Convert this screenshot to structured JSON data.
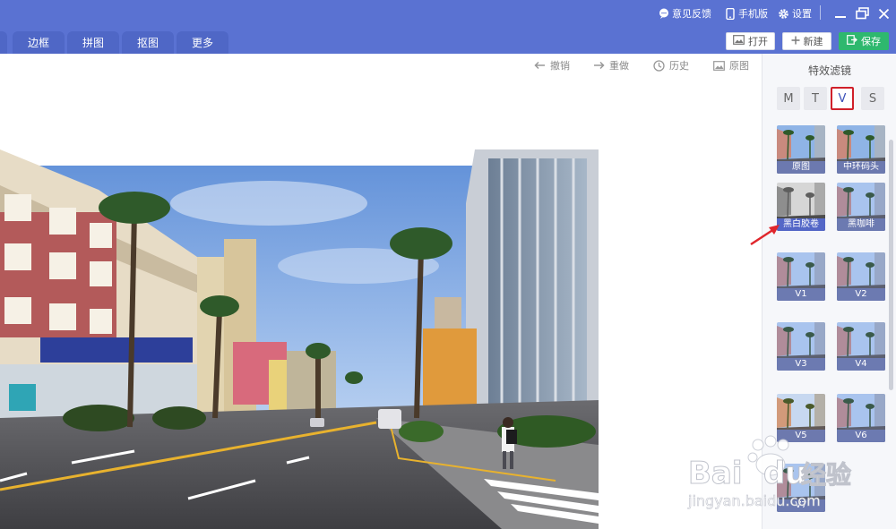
{
  "titlebar": {
    "feedback_label": "意见反馈",
    "mobile_label": "手机版",
    "settings_label": "设置"
  },
  "tabs": [
    {
      "label": ""
    },
    {
      "label": "边框"
    },
    {
      "label": "拼图"
    },
    {
      "label": "抠图"
    },
    {
      "label": "更多"
    }
  ],
  "actions": {
    "open_label": "打开",
    "new_label": "新建",
    "save_label": "保存"
  },
  "canvas_toolbar": {
    "undo_label": "撤销",
    "redo_label": "重做",
    "history_label": "历史",
    "original_label": "原图"
  },
  "filter_panel": {
    "title": "特效滤镜",
    "categories": [
      {
        "label": "M",
        "active": false
      },
      {
        "label": "T",
        "active": false
      },
      {
        "label": "V",
        "active": true
      },
      {
        "label": "S",
        "active": false
      }
    ],
    "filters": [
      {
        "label": "原图",
        "tint": "normal"
      },
      {
        "label": "中环码头",
        "tint": "normal"
      },
      {
        "label": "黑白胶卷",
        "tint": "gray"
      },
      {
        "label": "黑咖啡",
        "tint": "cool"
      },
      {
        "label": "V1",
        "tint": "cool"
      },
      {
        "label": "V2",
        "tint": "cool"
      },
      {
        "label": "V3",
        "tint": "cool"
      },
      {
        "label": "V4",
        "tint": "cool"
      },
      {
        "label": "V5",
        "tint": "warm"
      },
      {
        "label": "V6",
        "tint": "cool"
      },
      {
        "label": "V7",
        "tint": "cool"
      }
    ]
  },
  "colors": {
    "header_bg": "#5a72d2",
    "tab_bg": "#4f67c6",
    "save_green": "#2eb86e",
    "active_red": "#d0202a",
    "annotation_arrow": "#e0262c"
  },
  "watermark": {
    "brand_text": "Bai",
    "brand_text_2": "du",
    "brand_suffix": "经验",
    "url": "jingyan.baidu.com"
  }
}
